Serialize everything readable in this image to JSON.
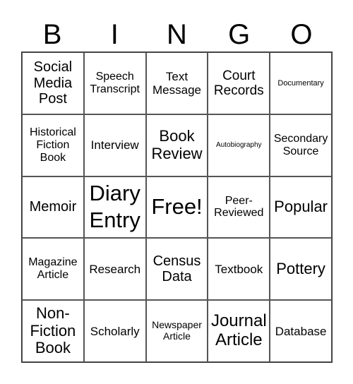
{
  "header": {
    "letters": [
      "B",
      "I",
      "N",
      "G",
      "O"
    ]
  },
  "board": {
    "rows": [
      [
        "Social Media Post",
        "Speech Transcript",
        "Text Message",
        "Court Records",
        "Documentary"
      ],
      [
        "Historical Fiction Book",
        "Interview",
        "Book Review",
        "Autobiography",
        "Secondary Source"
      ],
      [
        "Memoir",
        "Diary Entry",
        "Free!",
        "Peer-Reviewed",
        "Popular"
      ],
      [
        "Magazine Article",
        "Research",
        "Census Data",
        "Textbook",
        "Pottery"
      ],
      [
        "Non-Fiction Book",
        "Scholarly",
        "Newspaper Article",
        "Journal Article",
        "Database"
      ]
    ]
  }
}
